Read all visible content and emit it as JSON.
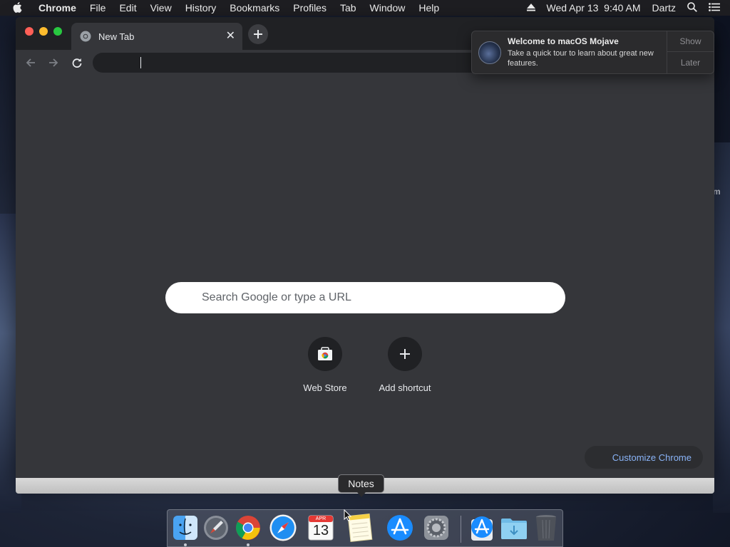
{
  "menubar": {
    "app_name": "Chrome",
    "items": [
      "File",
      "Edit",
      "View",
      "History",
      "Bookmarks",
      "Profiles",
      "Tab",
      "Window",
      "Help"
    ],
    "datetime": "Wed Apr 13  9:40 AM",
    "user": "Dartz"
  },
  "browser": {
    "tab_title": "New Tab",
    "tab_close_glyph": "✕",
    "omnibox_value": "",
    "search_placeholder": "Search Google or type a URL",
    "shortcuts": [
      {
        "label": "Web Store"
      },
      {
        "label": "Add shortcut"
      }
    ],
    "customize_label": "Customize Chrome"
  },
  "notification": {
    "title": "Welcome to macOS Mojave",
    "body": "Take a quick tour to learn about great new features.",
    "show_label": "Show",
    "later_label": "Later"
  },
  "dock": {
    "tooltip": "Notes",
    "calendar_month": "APR",
    "calendar_day": "13",
    "items": [
      "finder-icon",
      "launchpad-icon",
      "chrome-icon",
      "safari-icon",
      "calendar-icon",
      "notes-icon",
      "app-store-icon",
      "system-preferences-icon",
      "downloads-app-store-icon",
      "downloads-folder-icon",
      "trash-icon"
    ]
  },
  "colors": {
    "window_bg": "#35363a",
    "tabstrip_bg": "#202124",
    "link_blue": "#8ab4f8"
  }
}
